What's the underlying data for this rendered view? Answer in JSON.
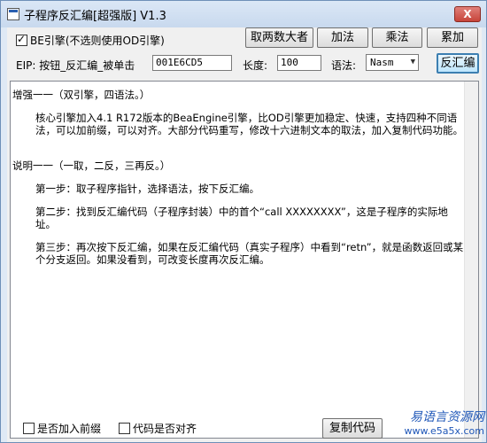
{
  "window": {
    "title": "子程序反汇编[超强版]  V1.3",
    "close_glyph": "X"
  },
  "toolbar": {
    "be_engine_label": "BE引擎(不选则使用OD引擎)",
    "be_engine_checked": true,
    "btn_take_max": "取两数大者",
    "btn_add": "加法",
    "btn_multiply": "乘法",
    "btn_accumulate": "累加"
  },
  "eip_row": {
    "eip_label": "EIP: 按钮_反汇编_被单击",
    "eip_value": "001E6CD5",
    "length_label": "长度:",
    "length_value": "100",
    "syntax_label": "语法:",
    "syntax_value": "Nasm",
    "disassemble_button": "反汇编"
  },
  "content": {
    "p1": "增强一一（双引擎，四语法。）",
    "p2": "核心引擎加入4.1 R172版本的BeaEngine引擎，比OD引擎更加稳定、快速，支持四种不同语法，可以加前缀，可以对齐。大部分代码重写，修改十六进制文本的取法，加入复制代码功能。",
    "p3": "说明一一（一取，二反，三再反。）",
    "p4": "第一步：取子程序指针，选择语法，按下反汇编。",
    "p5": "第二步：找到反汇编代码（子程序封装）中的首个“call XXXXXXXX”，这是子程序的实际地址。",
    "p6": "第三步：再次按下反汇编，如果在反汇编代码（真实子程序）中看到“retn”，就是函数返回或某个分支返回。如果没看到，可改变长度再次反汇编。"
  },
  "bottom": {
    "prefix_label": "是否加入前缀",
    "prefix_checked": false,
    "align_label": "代码是否对齐",
    "align_checked": false,
    "copy_button": "复制代码",
    "watermark_cn": "易语言资源网",
    "watermark_url": "www.e5a5x.com"
  }
}
